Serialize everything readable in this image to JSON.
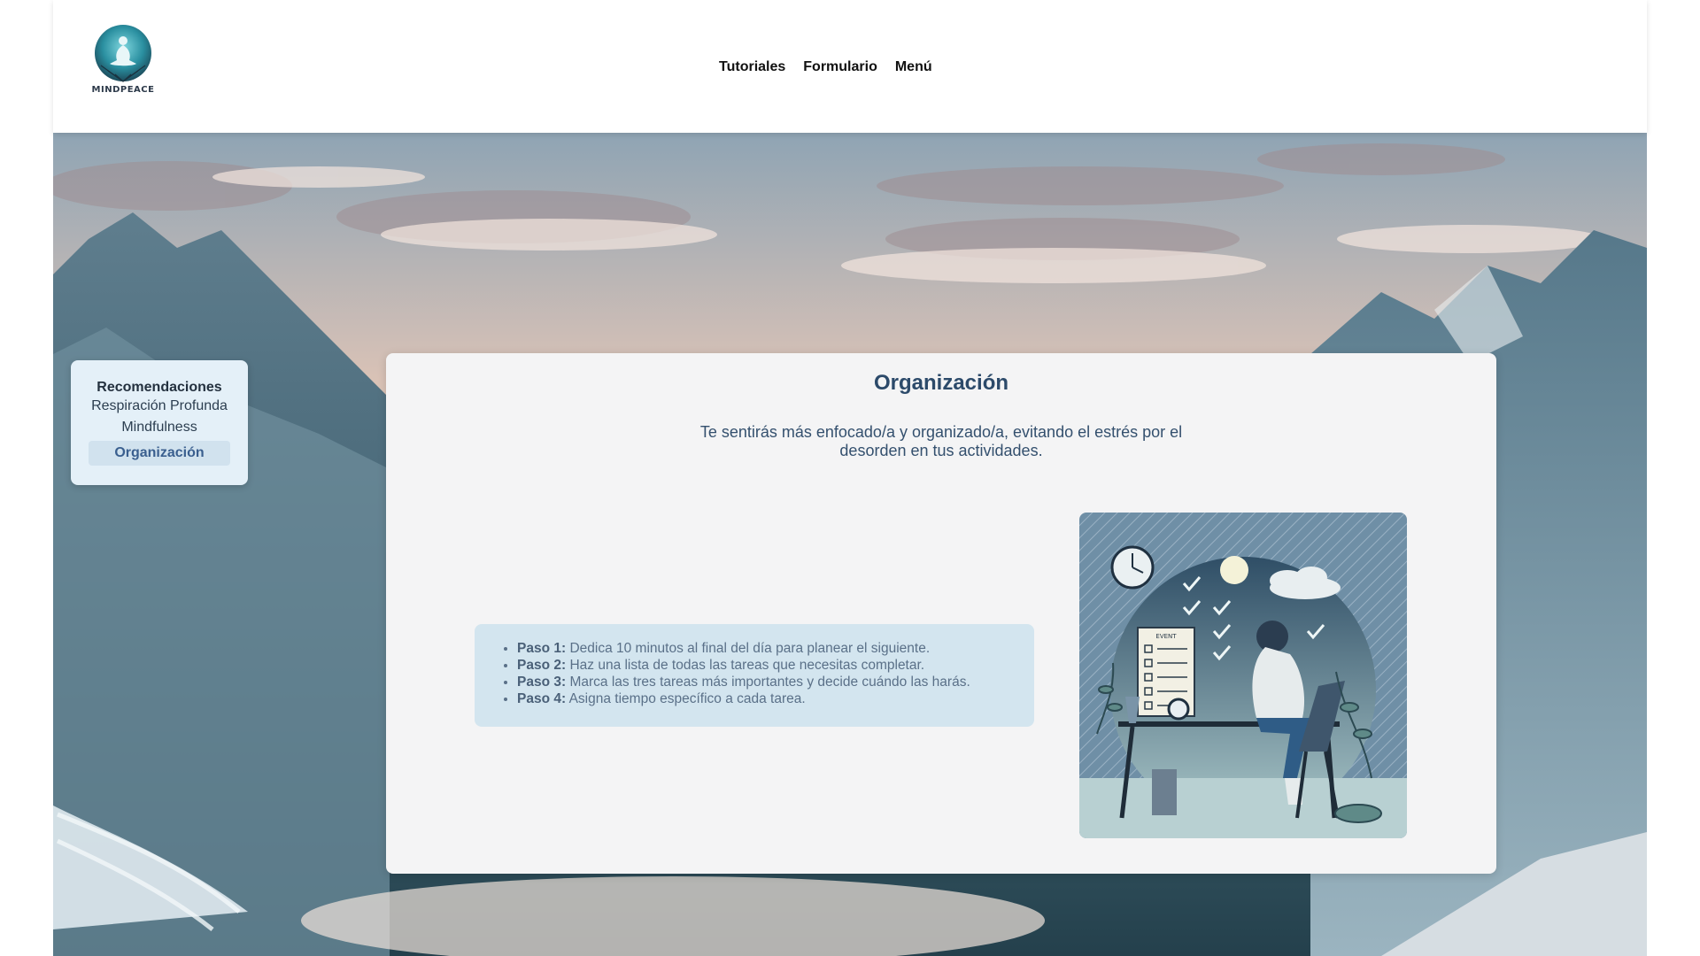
{
  "brand": {
    "name": "MINDPEACE"
  },
  "nav": {
    "items": [
      {
        "label": "Tutoriales"
      },
      {
        "label": "Formulario"
      },
      {
        "label": "Menú"
      }
    ]
  },
  "sidebar": {
    "title": "Recomendaciones",
    "items": [
      {
        "label": "Respiración Profunda",
        "active": false
      },
      {
        "label": "Mindfulness",
        "active": false
      },
      {
        "label": "Organización",
        "active": true
      }
    ]
  },
  "content": {
    "title": "Organización",
    "description": "Te sentirás más enfocado/a y organizado/a, evitando el estrés por el desorden en tus actividades.",
    "steps": [
      {
        "label": "Paso 1:",
        "text": "Dedica 10 minutos al final del día para planear el siguiente."
      },
      {
        "label": "Paso 2:",
        "text": "Haz una lista de todas las tareas que necesitas completar."
      },
      {
        "label": "Paso 3:",
        "text": "Marca las tres tareas más importantes y decide cuándo las harás."
      },
      {
        "label": "Paso 4:",
        "text": "Asigna tiempo específico a cada tarea."
      }
    ]
  },
  "colors": {
    "sidebar_bg": "#e4f0f8",
    "card_bg": "#f4f4f5",
    "steps_bg": "#d3e5ef",
    "title": "#2c4a6a"
  },
  "illustration": {
    "board_heading": "EVENT"
  }
}
